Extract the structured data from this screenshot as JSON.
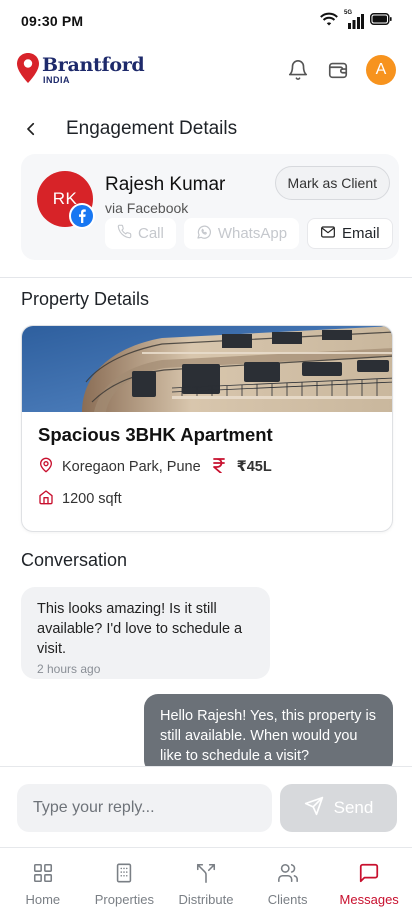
{
  "status_bar": {
    "time": "09:30 PM",
    "network": "5G"
  },
  "brand": {
    "name": "Brantford",
    "sub": "INDIA"
  },
  "page": {
    "title": "Engagement Details"
  },
  "lead": {
    "initials": "RK",
    "name": "Rajesh Kumar",
    "source": "via Facebook",
    "mark_label": "Mark as Client",
    "actions": {
      "call": "Call",
      "whatsapp": "WhatsApp",
      "email": "Email"
    }
  },
  "property": {
    "section_title": "Property Details",
    "title": "Spacious 3BHK Apartment",
    "location": "Koregaon Park, Pune",
    "price": "₹45L",
    "area": "1200 sqft"
  },
  "conversation": {
    "section_title": "Conversation",
    "messages": [
      {
        "text": "This looks amazing! Is it still available? I'd love to schedule a visit.",
        "time": "2 hours ago"
      },
      {
        "text": "Hello Rajesh! Yes, this property is still available. When would you like to schedule a visit?"
      }
    ]
  },
  "reply": {
    "placeholder": "Type your reply...",
    "send_label": "Send"
  },
  "user": {
    "initial": "A"
  },
  "nav": [
    {
      "label": "Home",
      "icon": "grid-icon"
    },
    {
      "label": "Properties",
      "icon": "building-icon"
    },
    {
      "label": "Distribute",
      "icon": "split-icon"
    },
    {
      "label": "Clients",
      "icon": "users-icon"
    },
    {
      "label": "Messages",
      "icon": "message-icon",
      "active": true
    }
  ],
  "colors": {
    "accent": "#c8102e",
    "avatar_red": "#d72328",
    "facebook": "#1877f2",
    "user_avatar": "#f7931e",
    "outgoing_bubble": "#6b7178"
  }
}
